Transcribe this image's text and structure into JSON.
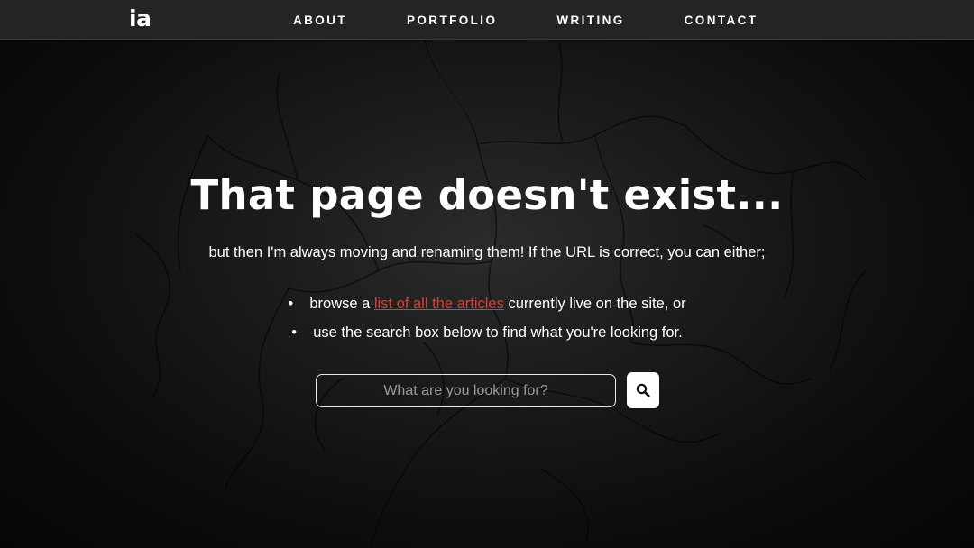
{
  "header": {
    "logo_text": "ia",
    "nav": [
      {
        "label": "ABOUT"
      },
      {
        "label": "PORTFOLIO"
      },
      {
        "label": "WRITING"
      },
      {
        "label": "CONTACT"
      }
    ]
  },
  "main": {
    "title": "That page doesn't exist...",
    "subtitle": "but then I'm always moving and renaming them! If the URL is correct, you can either;",
    "options": {
      "item1_prefix": "browse a",
      "item1_link": "list of all the articles",
      "item1_suffix": "currently live on the site, or",
      "item2": "use the search box below to find what you're looking for."
    },
    "search": {
      "placeholder": "What are you looking for?",
      "value": "",
      "button_icon": "search-icon"
    }
  },
  "colors": {
    "navbar": "#242424",
    "link_accent": "#e23a3a",
    "text": "#ffffff"
  }
}
